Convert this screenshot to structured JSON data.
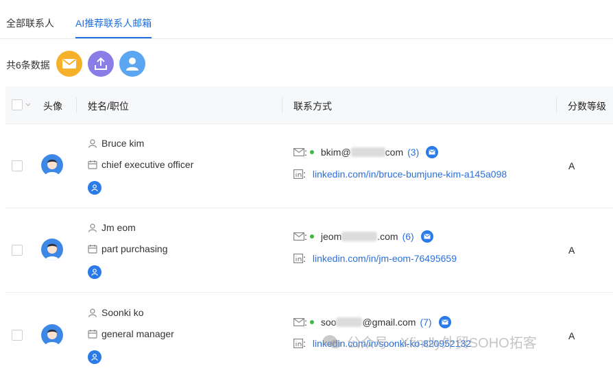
{
  "tabs": [
    {
      "label": "全部联系人",
      "active": false
    },
    {
      "label": "AI推荐联系人邮箱",
      "active": true
    }
  ],
  "toolbar": {
    "count_text": "共6条数据",
    "buttons": [
      {
        "icon": "mail-icon",
        "color": "#f5b12a"
      },
      {
        "icon": "upload-icon",
        "color": "#8a7de8"
      },
      {
        "icon": "user-icon",
        "color": "#5aa6f0"
      }
    ]
  },
  "table": {
    "columns": [
      "头像",
      "姓名/职位",
      "联系方式",
      "分数等级"
    ],
    "rows": [
      {
        "name": "Bruce kim",
        "title": "chief executive officer",
        "email_prefix": "bkim@",
        "email_suffix": "com",
        "email_count": "(3)",
        "linkedin": "linkedin.com/in/bruce-bumjune-kim-a145a098",
        "grade": "A"
      },
      {
        "name": "Jm eom",
        "title": "part purchasing",
        "email_prefix": "jeom",
        "email_suffix": ".com",
        "email_count": "(6)",
        "linkedin": "linkedin.com/in/jm-eom-76495659",
        "grade": "A"
      },
      {
        "name": "Soonki ko",
        "title": "general manager",
        "email_prefix": "soo",
        "email_suffix": "@gmail.com",
        "email_count": "(7)",
        "linkedin": "linkedin.com/in/soonki-ko-820952132",
        "grade": "A"
      }
    ]
  },
  "colon": ":",
  "watermark": "公众号 · Xfindly外贸SOHO拓客",
  "colors": {
    "accent": "#1d6fe0",
    "online": "#3fb83f"
  }
}
